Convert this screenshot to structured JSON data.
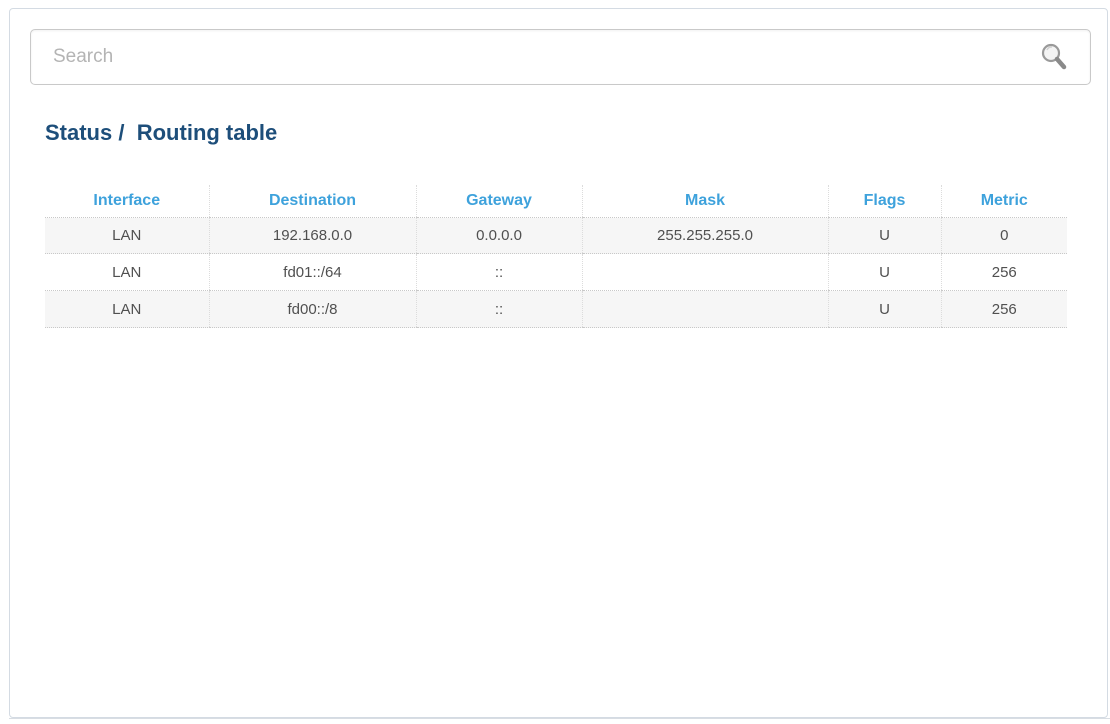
{
  "search": {
    "placeholder": "Search",
    "value": ""
  },
  "breadcrumb": {
    "section": "Status",
    "separator": "/",
    "page": "Routing table"
  },
  "routing_table": {
    "columns": [
      "Interface",
      "Destination",
      "Gateway",
      "Mask",
      "Flags",
      "Metric"
    ],
    "rows": [
      [
        "LAN",
        "192.168.0.0",
        "0.0.0.0",
        "255.255.255.0",
        "U",
        "0"
      ],
      [
        "LAN",
        "fd01::/64",
        "::",
        "",
        "U",
        "256"
      ],
      [
        "LAN",
        "fd00::/8",
        "::",
        "",
        "U",
        "256"
      ]
    ]
  },
  "colors": {
    "title": "#1d4e7a",
    "column_header": "#3ea2dc",
    "cell_text": "#505050",
    "row_stripe": "#f6f6f6"
  },
  "icons": {
    "search": "search-icon"
  }
}
